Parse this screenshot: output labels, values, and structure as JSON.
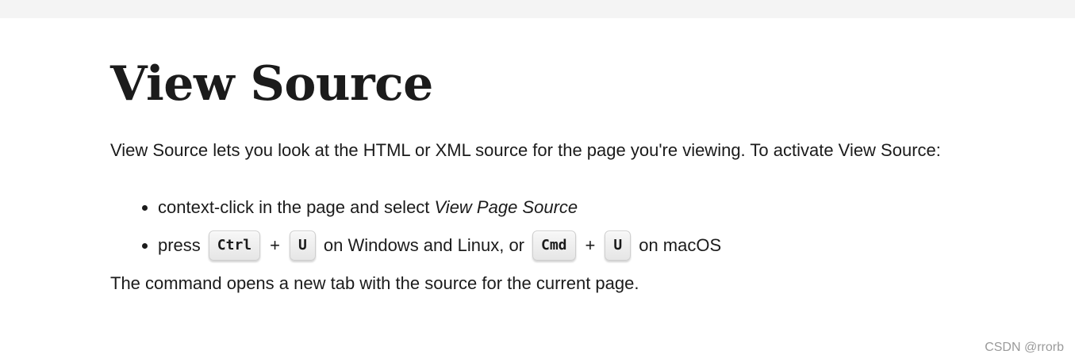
{
  "heading": "View Source",
  "intro": "View Source lets you look at the HTML or XML source for the page you're viewing. To activate View Source:",
  "steps": {
    "step1_prefix": "context-click in the page and select ",
    "step1_emphasis": "View Page Source",
    "step2_prefix": "press",
    "key_ctrl": "Ctrl",
    "plus": "+",
    "key_u": "U",
    "step2_middle": "on Windows and Linux, or",
    "key_cmd": "Cmd",
    "step2_suffix": "on macOS"
  },
  "outro": "The command opens a new tab with the source for the current page.",
  "watermark": "CSDN @rrorb"
}
